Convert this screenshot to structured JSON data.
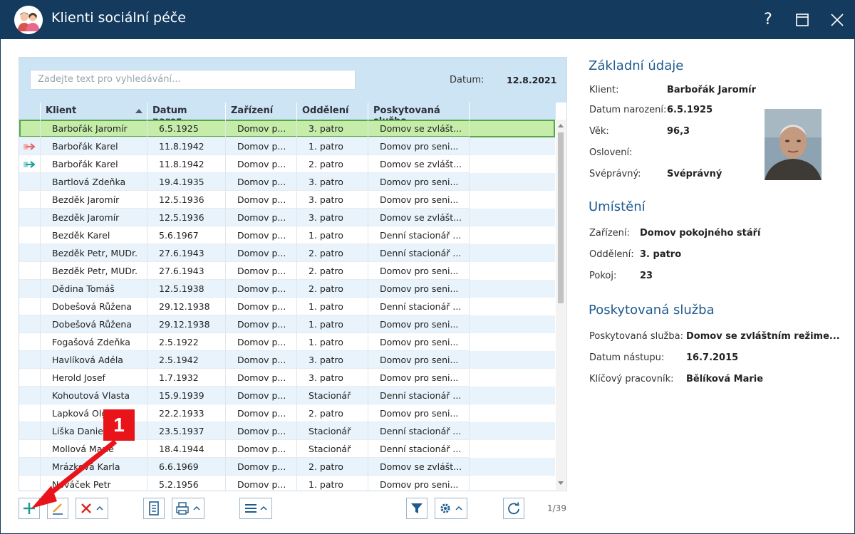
{
  "window": {
    "title": "Klienti sociální péče",
    "help_label": "?",
    "icons": [
      "app-clients-icon",
      "help-icon",
      "maximize-icon",
      "close-icon"
    ]
  },
  "search": {
    "placeholder": "Zadejte text pro vyhledávání..."
  },
  "date": {
    "label": "Datum:",
    "value": "12.8.2021"
  },
  "columns": [
    "Klient",
    "Datum naroz...",
    "Zařízení",
    "Oddělení",
    "Poskytovaná služba"
  ],
  "rows": [
    {
      "client": "Barbořák Jaromír",
      "born": "6.5.1925",
      "facility": "Domov p...",
      "dept": "3. patro",
      "service": "Domov se zvlášt...",
      "icon": ""
    },
    {
      "client": "Barbořák Karel",
      "born": "11.8.1942",
      "facility": "Domov p...",
      "dept": "1. patro",
      "service": "Domov pro seni...",
      "icon": "arrow-right-red"
    },
    {
      "client": "Barbořák Karel",
      "born": "11.8.1942",
      "facility": "Domov p...",
      "dept": "2. patro",
      "service": "Domov se zvlášt...",
      "icon": "arrow-right-teal"
    },
    {
      "client": "Bartlová Zdeňka",
      "born": "19.4.1935",
      "facility": "Domov p...",
      "dept": "3. patro",
      "service": "Domov pro seni...",
      "icon": ""
    },
    {
      "client": "Bezděk Jaromír",
      "born": "12.5.1936",
      "facility": "Domov p...",
      "dept": "3. patro",
      "service": "Domov pro seni...",
      "icon": ""
    },
    {
      "client": "Bezděk Jaromír",
      "born": "12.5.1936",
      "facility": "Domov p...",
      "dept": "3. patro",
      "service": "Domov se zvlášt...",
      "icon": ""
    },
    {
      "client": "Bezděk Karel",
      "born": "5.6.1967",
      "facility": "Domov p...",
      "dept": "1. patro",
      "service": "Denní stacionář ...",
      "icon": ""
    },
    {
      "client": "Bezděk Petr, MUDr.",
      "born": "27.6.1943",
      "facility": "Domov p...",
      "dept": "2. patro",
      "service": "Denní stacionář ...",
      "icon": ""
    },
    {
      "client": "Bezděk Petr, MUDr.",
      "born": "27.6.1943",
      "facility": "Domov p...",
      "dept": "2. patro",
      "service": "Domov pro seni...",
      "icon": ""
    },
    {
      "client": "Dědina Tomáš",
      "born": "12.5.1938",
      "facility": "Domov p...",
      "dept": "2. patro",
      "service": "Domov pro seni...",
      "icon": ""
    },
    {
      "client": "Dobešová Růžena",
      "born": "29.12.1938",
      "facility": "Domov p...",
      "dept": "1. patro",
      "service": "Denní stacionář ...",
      "icon": ""
    },
    {
      "client": "Dobešová Růžena",
      "born": "29.12.1938",
      "facility": "Domov p...",
      "dept": "1. patro",
      "service": "Domov pro seni...",
      "icon": ""
    },
    {
      "client": "Fogašová Zdeňka",
      "born": "2.5.1922",
      "facility": "Domov p...",
      "dept": "1. patro",
      "service": "Domov pro seni...",
      "icon": ""
    },
    {
      "client": "Havlíková Adéla",
      "born": "2.5.1942",
      "facility": "Domov p...",
      "dept": "3. patro",
      "service": "Domov pro seni...",
      "icon": ""
    },
    {
      "client": "Herold Josef",
      "born": "1.7.1932",
      "facility": "Domov p...",
      "dept": "3. patro",
      "service": "Domov pro seni...",
      "icon": ""
    },
    {
      "client": "Kohoutová Vlasta",
      "born": "15.9.1939",
      "facility": "Domov p...",
      "dept": "Stacionář",
      "service": "Denní stacionář ...",
      "icon": ""
    },
    {
      "client": "Lapková Olg",
      "born": "22.2.1933",
      "facility": "Domov p...",
      "dept": "2. patro",
      "service": "Domov pro seni...",
      "icon": ""
    },
    {
      "client": "Liška Daniel",
      "born": "23.5.1937",
      "facility": "Domov p...",
      "dept": "Stacionář",
      "service": "Denní stacionář ...",
      "icon": ""
    },
    {
      "client": "Mollová Marie",
      "born": "18.4.1944",
      "facility": "Domov p...",
      "dept": "Stacionář",
      "service": "Denní stacionář ...",
      "icon": ""
    },
    {
      "client": "Mrázková Karla",
      "born": "6.6.1969",
      "facility": "Domov p...",
      "dept": "2. patro",
      "service": "Domov se zvlášt...",
      "icon": ""
    },
    {
      "client": "Nováček Petr",
      "born": "5.2.1956",
      "facility": "Domov p...",
      "dept": "1. patro",
      "service": "Domov pro seni...",
      "icon": ""
    }
  ],
  "selected_row": 0,
  "counter": "1/39",
  "toolbar_icons": [
    "add-icon",
    "edit-icon",
    "delete-icon",
    "document-icon",
    "print-icon",
    "menu-icon",
    "filter-icon",
    "settings-icon",
    "refresh-icon"
  ],
  "details": {
    "basic": {
      "title": "Základní údaje",
      "client_label": "Klient:",
      "client": "Barbořák Jaromír",
      "born_label": "Datum narození:",
      "born": "6.5.1925",
      "age_label": "Věk:",
      "age": "96,3",
      "salutation_label": "Oslovení:",
      "salutation": "",
      "competent_label": "Svéprávný:",
      "competent": "Svéprávný"
    },
    "placement": {
      "title": "Umístění",
      "facility_label": "Zařízení:",
      "facility": "Domov pokojného stáří",
      "dept_label": "Oddělení:",
      "dept": "3. patro",
      "room_label": "Pokoj:",
      "room": "23"
    },
    "service": {
      "title": "Poskytovaná služba",
      "service_label": "Poskytovaná služba:",
      "service": "Domov se zvláštním režime...",
      "start_label": "Datum nástupu:",
      "start": "16.7.2015",
      "worker_label": "Klíčový pracovník:",
      "worker": "Bělíková Marie"
    }
  },
  "annotation": {
    "number": "1",
    "color": "#e8141a"
  },
  "colors": {
    "titlebar": "#143a5e",
    "header": "#cde4f5",
    "selected": "#c6ecaa",
    "accent": "#1e5b8f"
  }
}
